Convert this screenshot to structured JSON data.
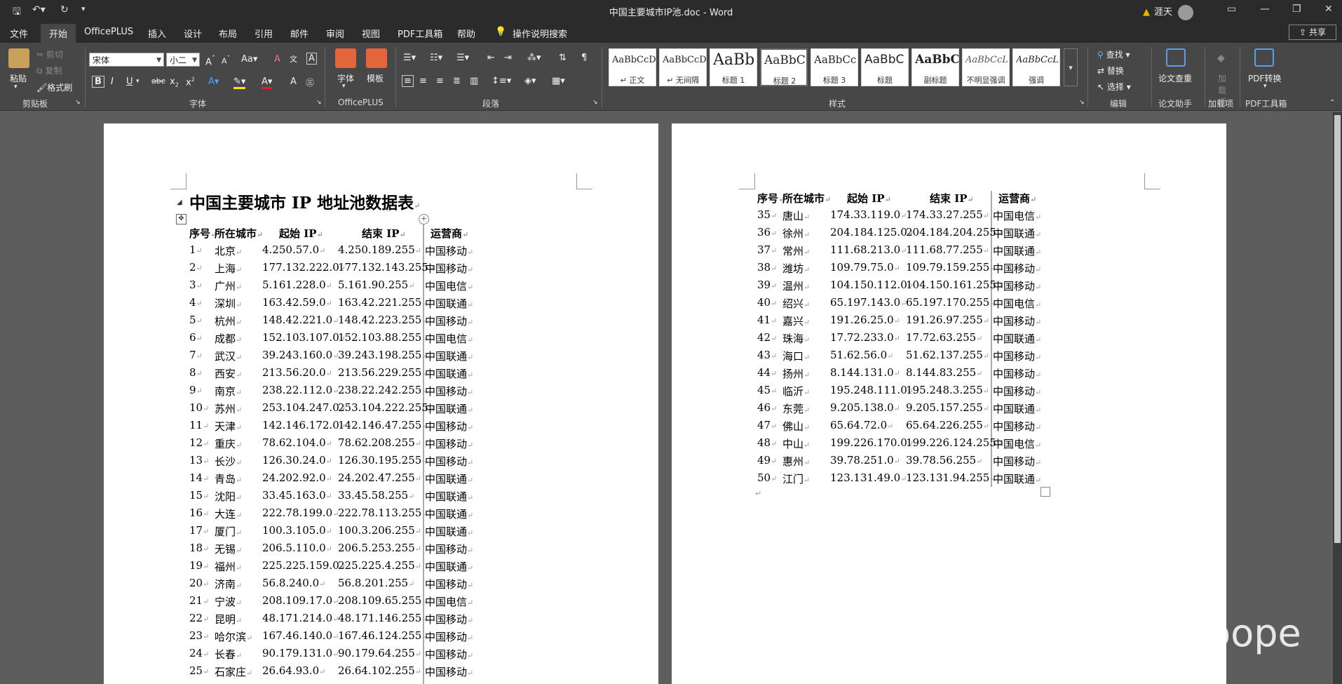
{
  "window": {
    "title": "中国主要城市IP池.doc  -  Word",
    "user_name": "涯天",
    "share_label": "共享"
  },
  "tabs": [
    "文件",
    "开始",
    "OfficePLUS",
    "插入",
    "设计",
    "布局",
    "引用",
    "邮件",
    "审阅",
    "视图",
    "PDF工具箱",
    "帮助"
  ],
  "tell_me": "操作说明搜索",
  "ribbon": {
    "clipboard": {
      "paste": "粘贴",
      "cut": "剪切",
      "copy": "复制",
      "format_painter": "格式刷",
      "label": "剪贴板"
    },
    "font": {
      "name": "宋体",
      "size": "小二",
      "label": "字体"
    },
    "officeplus": {
      "font_btn": "字体",
      "template_btn": "模板",
      "label": "OfficePLUS"
    },
    "paragraph": {
      "label": "段落"
    },
    "styles": {
      "label": "样式",
      "items": [
        {
          "preview": "AaBbCcDc",
          "name": "↵ 正文"
        },
        {
          "preview": "AaBbCcDc",
          "name": "↵ 无间隔"
        },
        {
          "preview": "AaBb",
          "name": "标题 1"
        },
        {
          "preview": "AaBbC",
          "name": "标题 2"
        },
        {
          "preview": "AaBbCc",
          "name": "标题 3"
        },
        {
          "preview": "AaBbC",
          "name": "标题"
        },
        {
          "preview": "AaBbC",
          "name": "副标题"
        },
        {
          "preview": "AaBbCcL",
          "name": "不明显强调"
        },
        {
          "preview": "AaBbCcL",
          "name": "强调"
        }
      ]
    },
    "editing": {
      "find": "查找",
      "replace": "替换",
      "select": "选择",
      "label": "编辑"
    },
    "paper": {
      "btn": "论文查重",
      "label": "论文助手"
    },
    "addins": {
      "btn": "加\n载项",
      "label": "加载项"
    },
    "pdf": {
      "btn": "PDF转换",
      "label": "PDF工具箱"
    }
  },
  "document": {
    "title": "中国主要城市 IP 地址池数据表",
    "headers": [
      "序号",
      "所在城市",
      "起始 IP",
      "结束 IP",
      "运营商"
    ],
    "rows_page1": [
      [
        "1",
        "北京",
        "4.250.57.0",
        "4.250.189.255",
        "中国移动"
      ],
      [
        "2",
        "上海",
        "177.132.222.0",
        "177.132.143.255",
        "中国移动"
      ],
      [
        "3",
        "广州",
        "5.161.228.0",
        "5.161.90.255",
        "中国电信"
      ],
      [
        "4",
        "深圳",
        "163.42.59.0",
        "163.42.221.255",
        "中国联通"
      ],
      [
        "5",
        "杭州",
        "148.42.221.0",
        "148.42.223.255",
        "中国移动"
      ],
      [
        "6",
        "成都",
        "152.103.107.0",
        "152.103.88.255",
        "中国电信"
      ],
      [
        "7",
        "武汉",
        "39.243.160.0",
        "39.243.198.255",
        "中国联通"
      ],
      [
        "8",
        "西安",
        "213.56.20.0",
        "213.56.229.255",
        "中国联通"
      ],
      [
        "9",
        "南京",
        "238.22.112.0",
        "238.22.242.255",
        "中国移动"
      ],
      [
        "10",
        "苏州",
        "253.104.247.0",
        "253.104.222.255",
        "中国联通"
      ],
      [
        "11",
        "天津",
        "142.146.172.0",
        "142.146.47.255",
        "中国移动"
      ],
      [
        "12",
        "重庆",
        "78.62.104.0",
        "78.62.208.255",
        "中国移动"
      ],
      [
        "13",
        "长沙",
        "126.30.24.0",
        "126.30.195.255",
        "中国移动"
      ],
      [
        "14",
        "青岛",
        "24.202.92.0",
        "24.202.47.255",
        "中国联通"
      ],
      [
        "15",
        "沈阳",
        "33.45.163.0",
        "33.45.58.255",
        "中国联通"
      ],
      [
        "16",
        "大连",
        "222.78.199.0",
        "222.78.113.255",
        "中国联通"
      ],
      [
        "17",
        "厦门",
        "100.3.105.0",
        "100.3.206.255",
        "中国联通"
      ],
      [
        "18",
        "无锡",
        "206.5.110.0",
        "206.5.253.255",
        "中国移动"
      ],
      [
        "19",
        "福州",
        "225.225.159.0",
        "225.225.4.255",
        "中国联通"
      ],
      [
        "20",
        "济南",
        "56.8.240.0",
        "56.8.201.255",
        "中国移动"
      ],
      [
        "21",
        "宁波",
        "208.109.17.0",
        "208.109.65.255",
        "中国电信"
      ],
      [
        "22",
        "昆明",
        "48.171.214.0",
        "48.171.146.255",
        "中国移动"
      ],
      [
        "23",
        "哈尔滨",
        "167.46.140.0",
        "167.46.124.255",
        "中国移动"
      ],
      [
        "24",
        "长春",
        "90.179.131.0",
        "90.179.64.255",
        "中国移动"
      ],
      [
        "25",
        "石家庄",
        "26.64.93.0",
        "26.64.102.255",
        "中国移动"
      ]
    ],
    "rows_page2": [
      [
        "35",
        "唐山",
        "174.33.119.0",
        "174.33.27.255",
        "中国电信"
      ],
      [
        "36",
        "徐州",
        "204.184.125.0",
        "204.184.204.255",
        "中国联通"
      ],
      [
        "37",
        "常州",
        "111.68.213.0",
        "111.68.77.255",
        "中国联通"
      ],
      [
        "38",
        "潍坊",
        "109.79.75.0",
        "109.79.159.255",
        "中国移动"
      ],
      [
        "39",
        "温州",
        "104.150.112.0",
        "104.150.161.255",
        "中国移动"
      ],
      [
        "40",
        "绍兴",
        "65.197.143.0",
        "65.197.170.255",
        "中国电信"
      ],
      [
        "41",
        "嘉兴",
        "191.26.25.0",
        "191.26.97.255",
        "中国移动"
      ],
      [
        "42",
        "珠海",
        "17.72.233.0",
        "17.72.63.255",
        "中国联通"
      ],
      [
        "43",
        "海口",
        "51.62.56.0",
        "51.62.137.255",
        "中国移动"
      ],
      [
        "44",
        "扬州",
        "8.144.131.0",
        "8.144.83.255",
        "中国移动"
      ],
      [
        "45",
        "临沂",
        "195.248.111.0",
        "195.248.3.255",
        "中国移动"
      ],
      [
        "46",
        "东莞",
        "9.205.138.0",
        "9.205.157.255",
        "中国联通"
      ],
      [
        "47",
        "佛山",
        "65.64.72.0",
        "65.64.226.255",
        "中国移动"
      ],
      [
        "48",
        "中山",
        "199.226.170.0",
        "199.226.124.255",
        "中国电信"
      ],
      [
        "49",
        "惠州",
        "39.78.251.0",
        "39.78.56.255",
        "中国移动"
      ],
      [
        "50",
        "江门",
        "123.131.49.0",
        "123.131.94.255",
        "中国联通"
      ]
    ]
  },
  "watermark": "知乎 @oope"
}
